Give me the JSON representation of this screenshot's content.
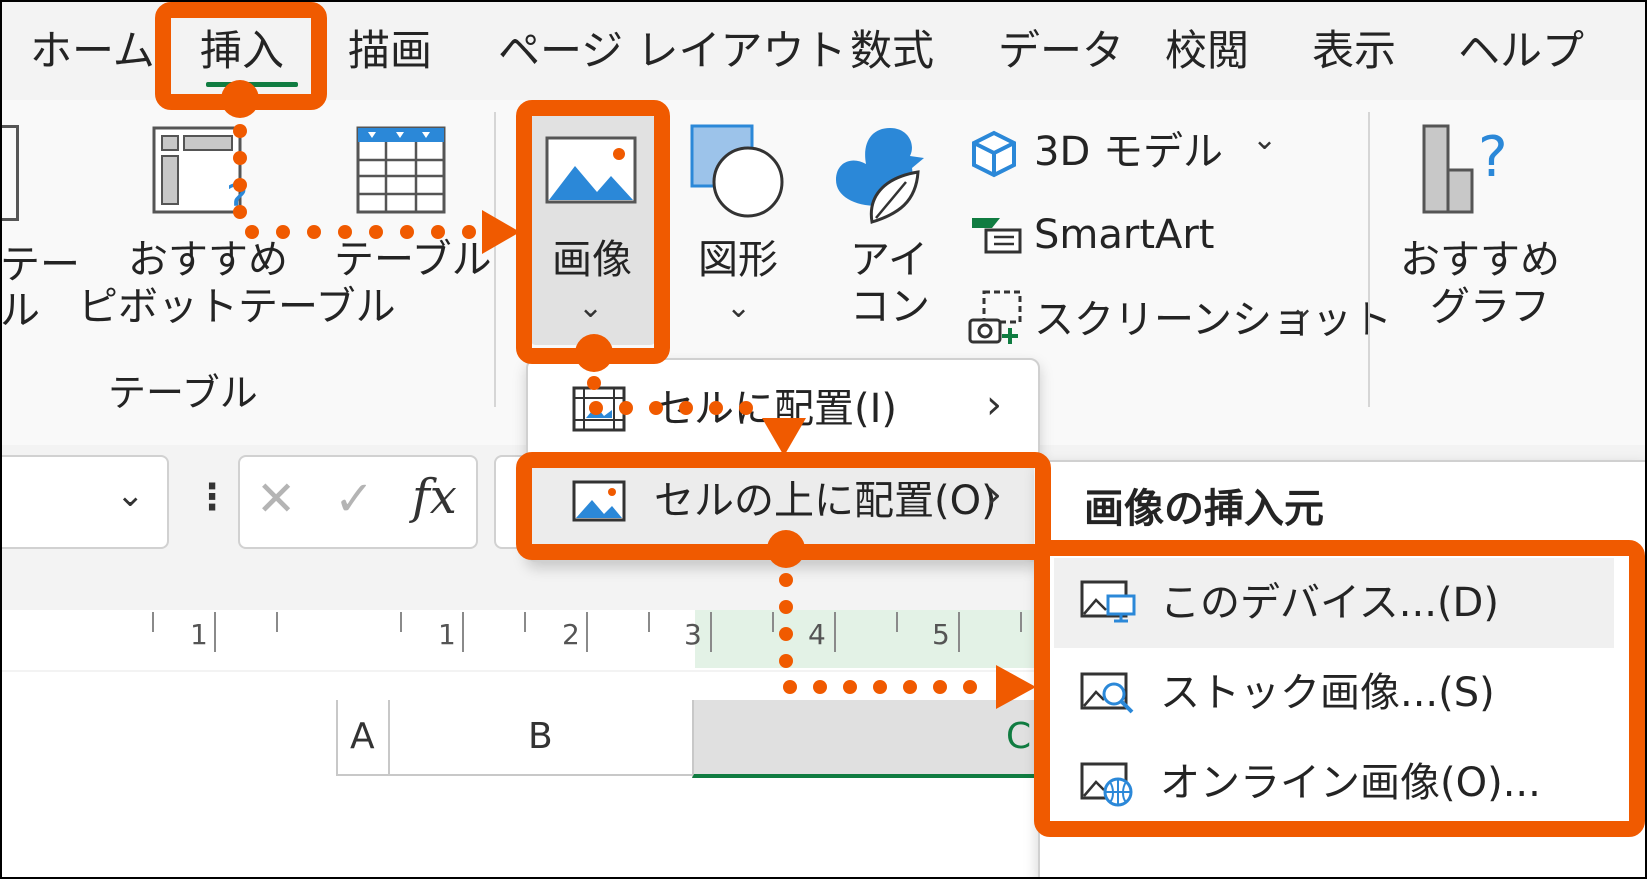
{
  "tabs": [
    "ホーム",
    "挿入",
    "描画",
    "ページ レイアウト",
    "数式",
    "データ",
    "校閲",
    "表示",
    "ヘルプ"
  ],
  "ribbon": {
    "pivot_cut_line1": "テー",
    "pivot_cut_line2": "ル",
    "recommended_pivot_line1": "おすすめ",
    "recommended_pivot_line2": "ピボットテーブル",
    "table": "テーブル",
    "group_table": "テーブル",
    "picture": "画像",
    "shapes": "図形",
    "icons_line1": "アイ",
    "icons_line2": "コン",
    "model3d": "3D モデル",
    "smartart": "SmartArt",
    "screenshot": "スクリーンショット",
    "recommended_chart_line1": "おすすめ",
    "recommended_chart_line2": "グラフ"
  },
  "formula_bar": {
    "fx": "fx"
  },
  "sheet": {
    "ruler_numbers": [
      "1",
      "1",
      "2",
      "3",
      "4",
      "5"
    ],
    "columns": [
      "A",
      "B",
      "C"
    ]
  },
  "picture_menu": {
    "place_in_cell": "セルに配置(I)",
    "place_over_cells": "セルの上に配置(O)"
  },
  "insert_from": {
    "header": "画像の挿入元",
    "this_device": "このデバイス...(D)",
    "stock_images": "ストック画像...(S)",
    "online_pictures": "オンライン画像(O)..."
  },
  "colors": {
    "accent": "#f05a00",
    "excel_green": "#107c41",
    "icon_blue": "#2b88d8"
  }
}
